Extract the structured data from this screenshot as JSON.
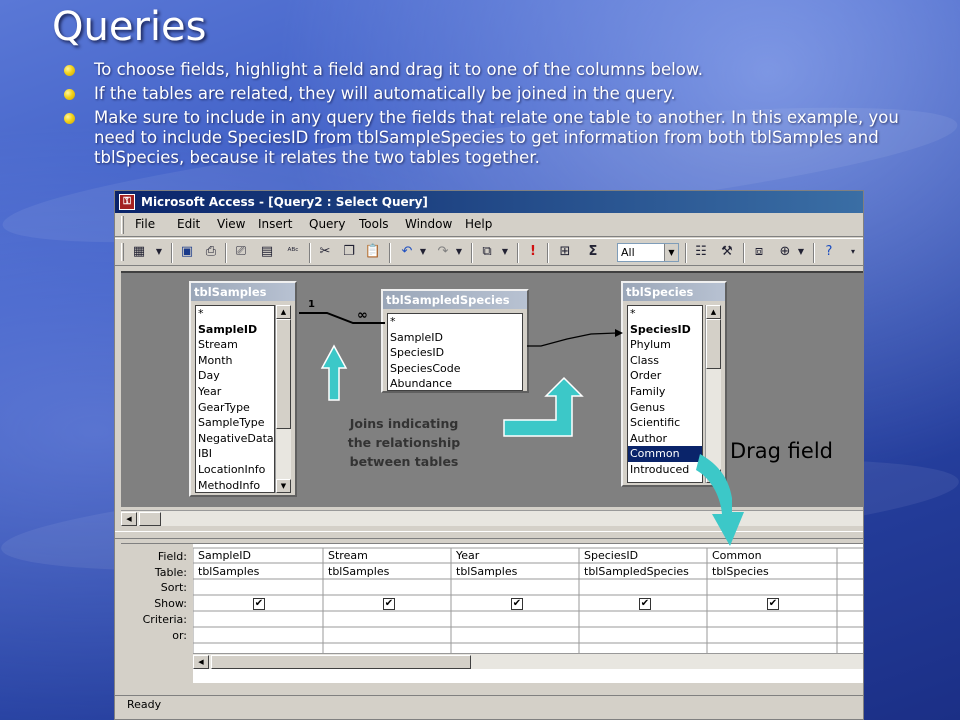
{
  "slide": {
    "title": "Queries",
    "bullets": [
      "To choose fields, highlight a field and drag it to one of the columns below.",
      "If the tables are related, they will automatically be joined in the query.",
      "Make sure to include in any query the fields that relate one table to another.  In this example, you need to include SpeciesID from tblSampleSpecies to get information from both tblSamples and tblSpecies, because it relates the two tables together."
    ],
    "bullet_color": "#f2d21a",
    "annotation_caption_lines": [
      "Joins indicating",
      "the relationship",
      "between tables"
    ],
    "drag_label": "Drag field",
    "arrow_color": "#3cc8c8"
  },
  "window": {
    "title": "Microsoft Access - [Query2 : Select Query]",
    "menu": [
      "File",
      "Edit",
      "View",
      "Insert",
      "Query",
      "Tools",
      "Window",
      "Help"
    ],
    "toolbar": {
      "icons": [
        "datasheet-view-icon",
        "save-icon",
        "print-preview-icon",
        "print-icon",
        "spelling-icon",
        "cut-icon",
        "copy-icon",
        "paste-icon",
        "undo-icon",
        "redo-icon",
        "query-type-icon",
        "run-icon",
        "show-table-icon",
        "totals-icon",
        "properties-icon",
        "build-icon",
        "database-window-icon",
        "new-object-icon",
        "help-icon"
      ],
      "top_values": "All"
    },
    "status": "Ready"
  },
  "tables": [
    {
      "name": "tblSamples",
      "fields": [
        "*",
        "SampleID",
        "Stream",
        "Month",
        "Day",
        "Year",
        "GearType",
        "SampleType",
        "NegativeData",
        "IBI",
        "LocationInfo",
        "MethodInfo"
      ],
      "keys": [
        "SampleID"
      ]
    },
    {
      "name": "tblSampledSpecies",
      "fields": [
        "*",
        "SampleID",
        "SpeciesID",
        "SpeciesCode",
        "Abundance"
      ],
      "keys": []
    },
    {
      "name": "tblSpecies",
      "fields": [
        "*",
        "SpeciesID",
        "Phylum",
        "Class",
        "Order",
        "Family",
        "Genus",
        "Scientific",
        "Author",
        "Common",
        "Introduced"
      ],
      "keys": [
        "SpeciesID"
      ],
      "selected": "Common"
    }
  ],
  "joins": [
    {
      "from": "tblSamples.SampleID",
      "to": "tblSampledSpecies.SampleID",
      "from_label": "1",
      "to_label": "∞"
    },
    {
      "from": "tblSampledSpecies.SpeciesID",
      "to": "tblSpecies.SpeciesID"
    }
  ],
  "grid": {
    "row_labels": [
      "Field:",
      "Table:",
      "Sort:",
      "Show:",
      "Criteria:",
      "or:"
    ],
    "columns": [
      {
        "field": "SampleID",
        "table": "tblSamples",
        "show": true
      },
      {
        "field": "Stream",
        "table": "tblSamples",
        "show": true
      },
      {
        "field": "Year",
        "table": "tblSamples",
        "show": true
      },
      {
        "field": "SpeciesID",
        "table": "tblSampledSpecies",
        "show": true
      },
      {
        "field": "Common",
        "table": "tblSpecies",
        "show": true
      }
    ]
  }
}
